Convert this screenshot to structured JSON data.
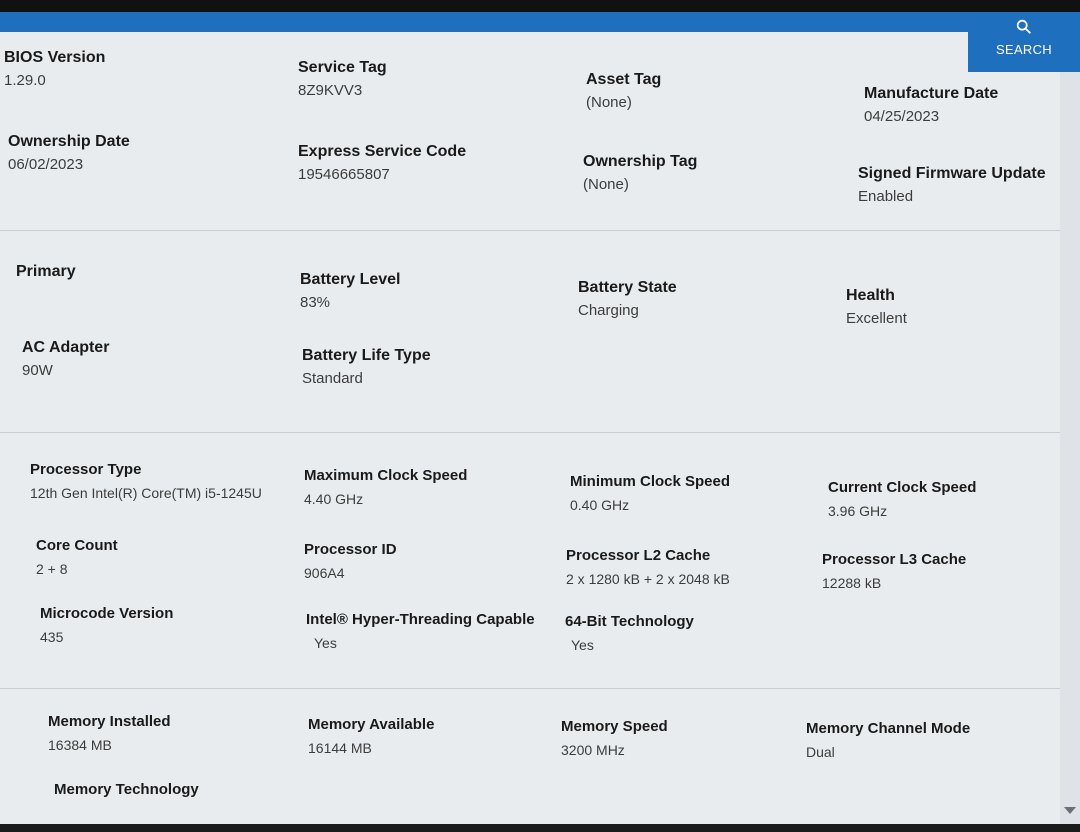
{
  "header": {
    "search_label": "SEARCH",
    "search_icon": "search-icon"
  },
  "system": {
    "bios_version": {
      "label": "BIOS Version",
      "value": "1.29.0"
    },
    "service_tag": {
      "label": "Service Tag",
      "value": "8Z9KVV3"
    },
    "asset_tag": {
      "label": "Asset Tag",
      "value": "(None)"
    },
    "manufacture_date": {
      "label": "Manufacture Date",
      "value": "04/25/2023"
    },
    "ownership_date": {
      "label": "Ownership Date",
      "value": "06/02/2023"
    },
    "express_service_code": {
      "label": "Express Service Code",
      "value": "19546665807"
    },
    "ownership_tag": {
      "label": "Ownership Tag",
      "value": "(None)"
    },
    "signed_firmware_update": {
      "label": "Signed Firmware Update",
      "value": "Enabled"
    }
  },
  "battery": {
    "primary": {
      "label": "Primary"
    },
    "battery_level": {
      "label": "Battery Level",
      "value": "83%"
    },
    "battery_state": {
      "label": "Battery State",
      "value": "Charging"
    },
    "health": {
      "label": "Health",
      "value": "Excellent"
    },
    "ac_adapter": {
      "label": "AC Adapter",
      "value": "90W"
    },
    "battery_life_type": {
      "label": "Battery Life Type",
      "value": "Standard"
    }
  },
  "processor": {
    "processor_type": {
      "label": "Processor Type",
      "value": "12th Gen Intel(R) Core(TM) i5-1245U"
    },
    "max_clock": {
      "label": "Maximum Clock Speed",
      "value": "4.40 GHz"
    },
    "min_clock": {
      "label": "Minimum Clock Speed",
      "value": "0.40 GHz"
    },
    "current_clock": {
      "label": "Current Clock Speed",
      "value": "3.96 GHz"
    },
    "core_count": {
      "label": "Core Count",
      "value": "2 + 8"
    },
    "processor_id": {
      "label": "Processor ID",
      "value": "906A4"
    },
    "l2_cache": {
      "label": "Processor L2 Cache",
      "value": "2 x 1280  kB + 2 x 2048  kB"
    },
    "l3_cache": {
      "label": "Processor L3 Cache",
      "value": "12288 kB"
    },
    "microcode": {
      "label": "Microcode Version",
      "value": "435"
    },
    "hyperthreading": {
      "label": "Intel® Hyper-Threading Capable",
      "value": "Yes"
    },
    "bit64": {
      "label": "64-Bit Technology",
      "value": "Yes"
    }
  },
  "memory": {
    "installed": {
      "label": "Memory Installed",
      "value": "16384 MB"
    },
    "available": {
      "label": "Memory Available",
      "value": "16144 MB"
    },
    "speed": {
      "label": "Memory Speed",
      "value": "3200 MHz"
    },
    "channel_mode": {
      "label": "Memory Channel Mode",
      "value": "Dual"
    },
    "technology": {
      "label": "Memory Technology"
    }
  }
}
